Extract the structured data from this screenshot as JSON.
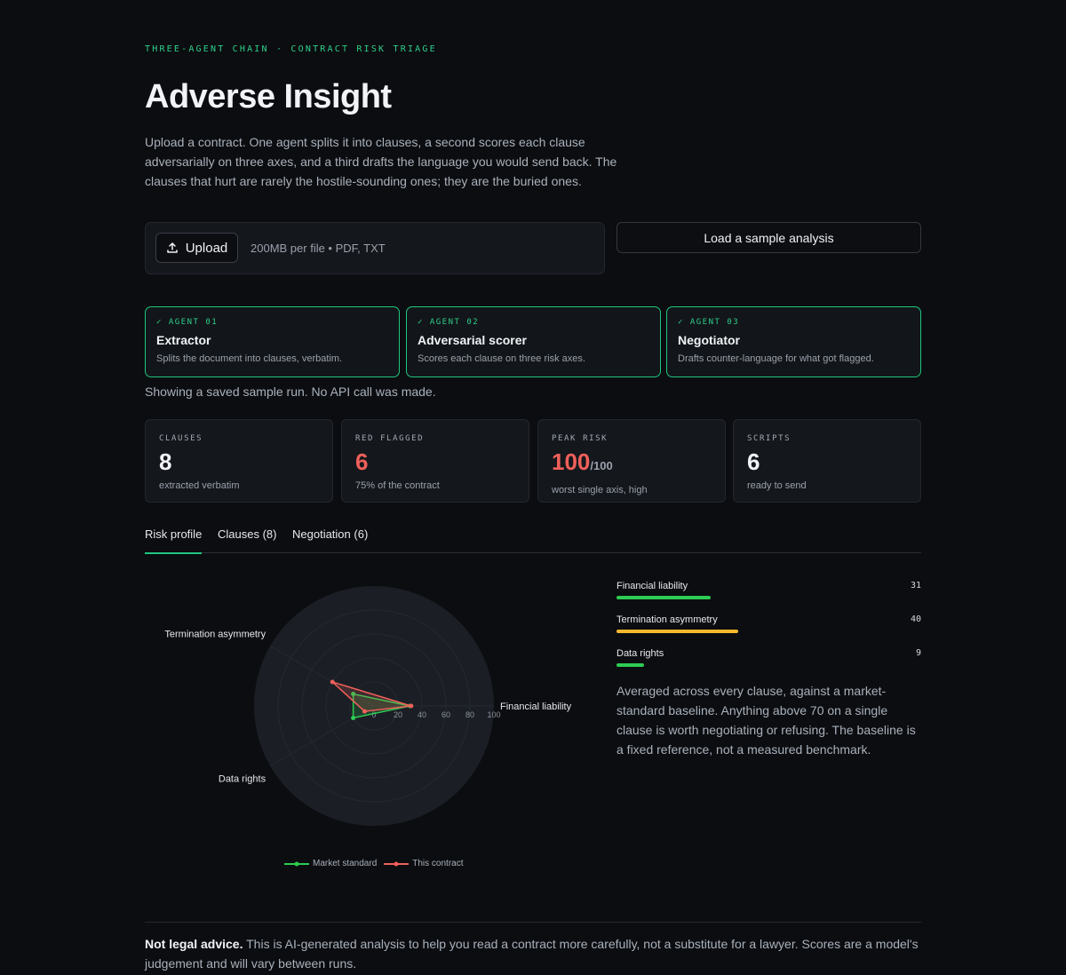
{
  "header": {
    "eyebrow": "THREE-AGENT CHAIN · CONTRACT RISK TRIAGE",
    "title": "Adverse Insight",
    "intro": "Upload a contract. One agent splits it into clauses, a second scores each clause adversarially on three axes, and a third drafts the language you would send back. The clauses that hurt are rarely the hostile-sounding ones; they are the buried ones."
  },
  "upload": {
    "button_label": "Upload",
    "hint": "200MB per file • PDF, TXT",
    "sample_label": "Load a sample analysis"
  },
  "agents": [
    {
      "tag": "✓ AGENT 01",
      "name": "Extractor",
      "desc": "Splits the document into clauses, verbatim."
    },
    {
      "tag": "✓ AGENT 02",
      "name": "Adversarial scorer",
      "desc": "Scores each clause on three risk axes."
    },
    {
      "tag": "✓ AGENT 03",
      "name": "Negotiator",
      "desc": "Drafts counter-language for what got flagged."
    }
  ],
  "status_note": "Showing a saved sample run. No API call was made.",
  "stats": [
    {
      "label": "CLAUSES",
      "value": "8",
      "suffix": "",
      "sub": "extracted verbatim"
    },
    {
      "label": "RED FLAGGED",
      "value": "6",
      "suffix": "",
      "sub": "75% of the contract"
    },
    {
      "label": "PEAK RISK",
      "value": "100",
      "suffix": "/100",
      "sub": "worst single axis, high"
    },
    {
      "label": "SCRIPTS",
      "value": "6",
      "suffix": "",
      "sub": "ready to send"
    }
  ],
  "tabs": [
    "Risk profile",
    "Clauses (8)",
    "Negotiation (6)"
  ],
  "chart_data": {
    "type": "radar",
    "axes": [
      "Financial liability",
      "Termination asymmetry",
      "Data rights"
    ],
    "ticks": [
      0,
      20,
      40,
      60,
      80,
      100
    ],
    "range": [
      0,
      100
    ],
    "legend_placement": "bottom",
    "series": [
      {
        "name": "Market standard",
        "values": [
          30,
          20,
          20
        ],
        "color": "#2ecc52"
      },
      {
        "name": "This contract",
        "values": [
          31,
          40,
          9
        ],
        "color": "#f0605a"
      }
    ]
  },
  "bars": [
    {
      "label": "Financial liability",
      "value": 31,
      "color": "#2ecc52"
    },
    {
      "label": "Termination asymmetry",
      "value": 40,
      "color": "#f5b82e"
    },
    {
      "label": "Data rights",
      "value": 9,
      "color": "#2ecc52"
    }
  ],
  "avg_note": "Averaged across every clause, against a market-standard baseline. Anything above 70 on a single clause is worth negotiating or refusing. The baseline is a fixed reference, not a measured benchmark.",
  "footer": {
    "bold": "Not legal advice.",
    "text": " This is AI-generated analysis to help you read a contract more carefully, not a substitute for a lawyer. Scores are a model's judgement and will vary between runs."
  }
}
